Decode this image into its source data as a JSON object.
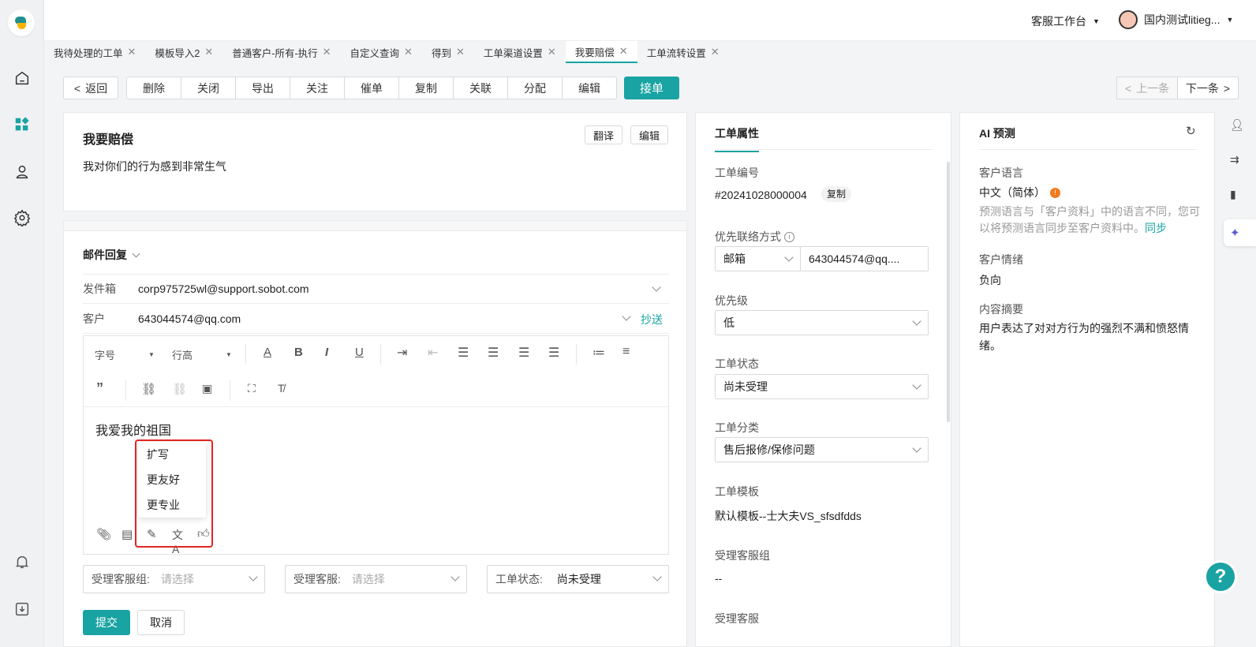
{
  "header": {
    "workspace": "客服工作台",
    "user": "国内测试litieg..."
  },
  "tabs": [
    {
      "label": "我待处理的工单"
    },
    {
      "label": "模板导入2"
    },
    {
      "label": "普通客户-所有-执行"
    },
    {
      "label": "自定义查询"
    },
    {
      "label": "得到"
    },
    {
      "label": "工单渠道设置"
    },
    {
      "label": "我要赔偿",
      "active": true
    },
    {
      "label": "工单流转设置"
    }
  ],
  "toolbar": {
    "back": "返回",
    "buttons": [
      "删除",
      "关闭",
      "导出",
      "关注",
      "催单",
      "复制",
      "关联",
      "分配",
      "编辑"
    ],
    "accept": "接单",
    "prev": "上一条",
    "next": "下一条"
  },
  "ticket": {
    "title": "我要赔偿",
    "description": "我对你们的行为感到非常生气",
    "translate": "翻译",
    "edit": "编辑"
  },
  "reply": {
    "mode": "邮件回复",
    "from_label": "发件箱",
    "from_value": "corp975725wl@support.sobot.com",
    "to_label": "客户",
    "to_value": "643044574@qq.com",
    "cc": "抄送",
    "font_size": "字号",
    "line_height": "行高",
    "body": "我爱我的祖国",
    "ai_menu": [
      "扩写",
      "更友好",
      "更专业"
    ],
    "group_label": "受理客服组:",
    "group_placeholder": "请选择",
    "agent_label": "受理客服:",
    "agent_placeholder": "请选择",
    "status_label": "工单状态:",
    "status_value": "尚未受理",
    "submit": "提交",
    "cancel": "取消"
  },
  "properties": {
    "tab": "工单属性",
    "number_label": "工单编号",
    "number_value": "#20241028000004",
    "copy": "复制",
    "contact_label": "优先联络方式",
    "contact_type": "邮箱",
    "contact_value": "643044574@qq....",
    "priority_label": "优先级",
    "priority_value": "低",
    "status_label": "工单状态",
    "status_value": "尚未受理",
    "category_label": "工单分类",
    "category_value": "售后报修/保修问题",
    "template_label": "工单模板",
    "template_value": "默认模板--士大夫VS_sfsdfdds",
    "group_label": "受理客服组",
    "group_value": "--",
    "agent_label": "受理客服"
  },
  "ai": {
    "title": "AI 预测",
    "lang_label": "客户语言",
    "lang_value": "中文（简体）",
    "lang_note": "预测语言与「客户资料」中的语言不同，您可以将预测语言同步至客户资料中。",
    "sync": "同步",
    "emotion_label": "客户情绪",
    "emotion_value": "负向",
    "summary_label": "内容摘要",
    "summary_value": "用户表达了对对方行为的强烈不满和愤怒情绪。"
  },
  "colors": {
    "accent": "#19a3a3",
    "highlight": "#e0261e"
  }
}
